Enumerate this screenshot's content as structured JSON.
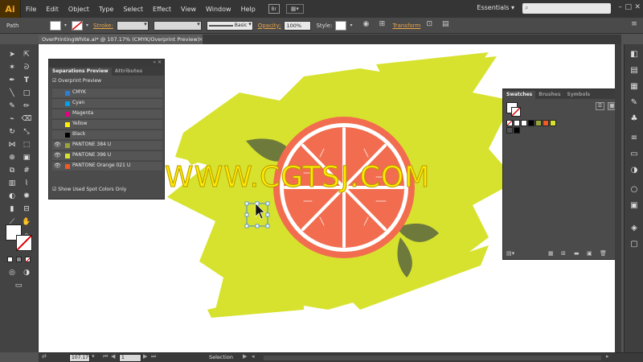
{
  "app": {
    "logo": "Ai",
    "menus": [
      "File",
      "Edit",
      "Object",
      "Type",
      "Select",
      "Effect",
      "View",
      "Window",
      "Help"
    ],
    "bridge_label": "Br",
    "workspace": "Essentials ▾"
  },
  "controlbar": {
    "selection_type": "Path",
    "stroke_label": "Stroke:",
    "brush_style": "Basic",
    "opacity_label": "Opacity:",
    "opacity_value": "100%",
    "style_label": "Style:",
    "transform_label": "Transform"
  },
  "document": {
    "tab_title": "OverPrintingWhite.ai* @ 107.17% (CMYK/Overprint Preview)",
    "close": "×"
  },
  "separations_panel": {
    "tabs": [
      "Separations Preview",
      "Attributes"
    ],
    "overprint_preview_label": "Overprint Preview",
    "rows": [
      {
        "name": "CMYK",
        "eye": "",
        "color": "#2d7dd2"
      },
      {
        "name": "Cyan",
        "eye": "",
        "color": "#00a0e9"
      },
      {
        "name": "Magenta",
        "eye": "",
        "color": "#e4007f"
      },
      {
        "name": "Yellow",
        "eye": "",
        "color": "#fff100"
      },
      {
        "name": "Black",
        "eye": "",
        "color": "#000000"
      },
      {
        "name": "PANTONE 384 U",
        "eye": "👁",
        "color": "#9aa33a"
      },
      {
        "name": "PANTONE 396 U",
        "eye": "👁",
        "color": "#d6e22e"
      },
      {
        "name": "PANTONE Orange 021 U",
        "eye": "👁",
        "color": "#f15a24"
      }
    ],
    "show_used_label": "Show Used Spot Colors Only"
  },
  "swatches_panel": {
    "tabs": [
      "Swatches",
      "Brushes",
      "Symbols"
    ]
  },
  "statusbar": {
    "zoom": "107.17%",
    "page": "1",
    "tool": "Selection"
  },
  "watermark": "WWW.CGTSJ.COM",
  "colors": {
    "splash": "#d7e22e",
    "orange_rind": "#f26c4f",
    "orange_flesh": "#f26c4f",
    "leaf": "#6e7a3c",
    "accent_link": "#e8a44c"
  }
}
